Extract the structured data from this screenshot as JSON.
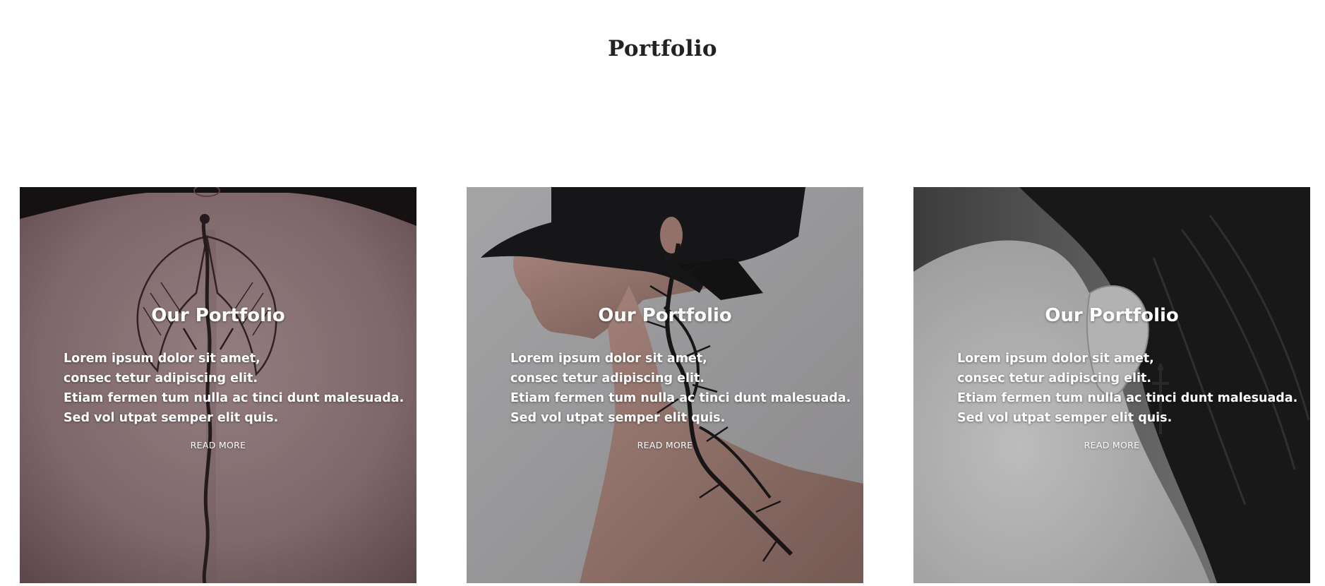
{
  "page": {
    "title": "Portfolio"
  },
  "cards": [
    {
      "heading": "Our Portfolio",
      "lines": [
        "Lorem ipsum dolor sit amet,",
        "consec tetur adipiscing elit.",
        "Etiam fermen tum nulla ac tinci dunt malesuada.",
        "Sed vol utpat semper elit quis."
      ],
      "link_label": "READ MORE",
      "image_subject": "back-dragon-tattoo-photo"
    },
    {
      "heading": "Our Portfolio",
      "lines": [
        "Lorem ipsum dolor sit amet,",
        "consec tetur adipiscing elit.",
        "Etiam fermen tum nulla ac tinci dunt malesuada.",
        "Sed vol utpat semper elit quis."
      ],
      "link_label": "READ MORE",
      "image_subject": "neck-thorn-tattoo-photo"
    },
    {
      "heading": "Our Portfolio",
      "lines": [
        "Lorem ipsum dolor sit amet,",
        "consec tetur adipiscing elit.",
        "Etiam fermen tum nulla ac tinci dunt malesuada.",
        "Sed vol utpat semper elit quis."
      ],
      "link_label": "READ MORE",
      "image_subject": "behind-ear-dagger-tattoo-photo"
    }
  ],
  "colors": {
    "background": "#ffffff",
    "title": "#222222",
    "overlay_text": "#ffffff"
  }
}
